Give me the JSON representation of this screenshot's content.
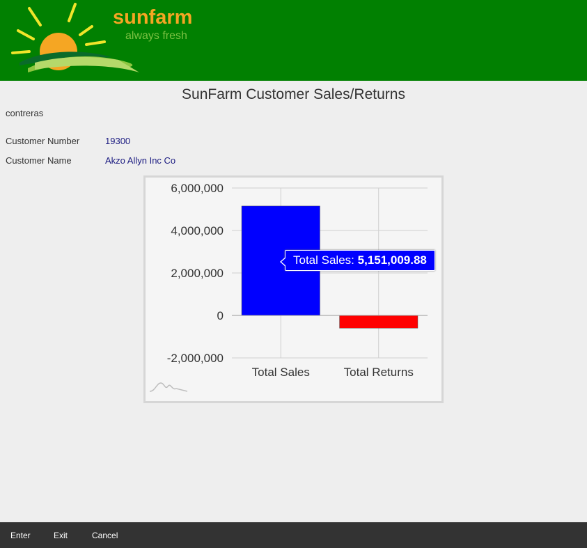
{
  "header": {
    "brand": "sunfarm",
    "tagline": "always fresh"
  },
  "page": {
    "title": "SunFarm Customer Sales/Returns",
    "user": "contreras"
  },
  "customer": {
    "number_label": "Customer Number",
    "number_value": "19300",
    "name_label": "Customer Name",
    "name_value": "Akzo Allyn Inc Co"
  },
  "chart_data": {
    "type": "bar",
    "categories": [
      "Total Sales",
      "Total Returns"
    ],
    "values": [
      5151009.88,
      -600000
    ],
    "colors": [
      "#0000ff",
      "#ff0000"
    ],
    "yticks": [
      6000000,
      4000000,
      2000000,
      0,
      -2000000
    ],
    "ytick_labels": [
      "6,000,000",
      "4,000,000",
      "2,000,000",
      "0",
      "-2,000,000"
    ],
    "ylim": [
      -2000000,
      6000000
    ],
    "grid": true,
    "tooltip": {
      "label": "Total Sales:",
      "value": "5,151,009.88"
    }
  },
  "footer": {
    "enter": "Enter",
    "exit": "Exit",
    "cancel": "Cancel"
  }
}
